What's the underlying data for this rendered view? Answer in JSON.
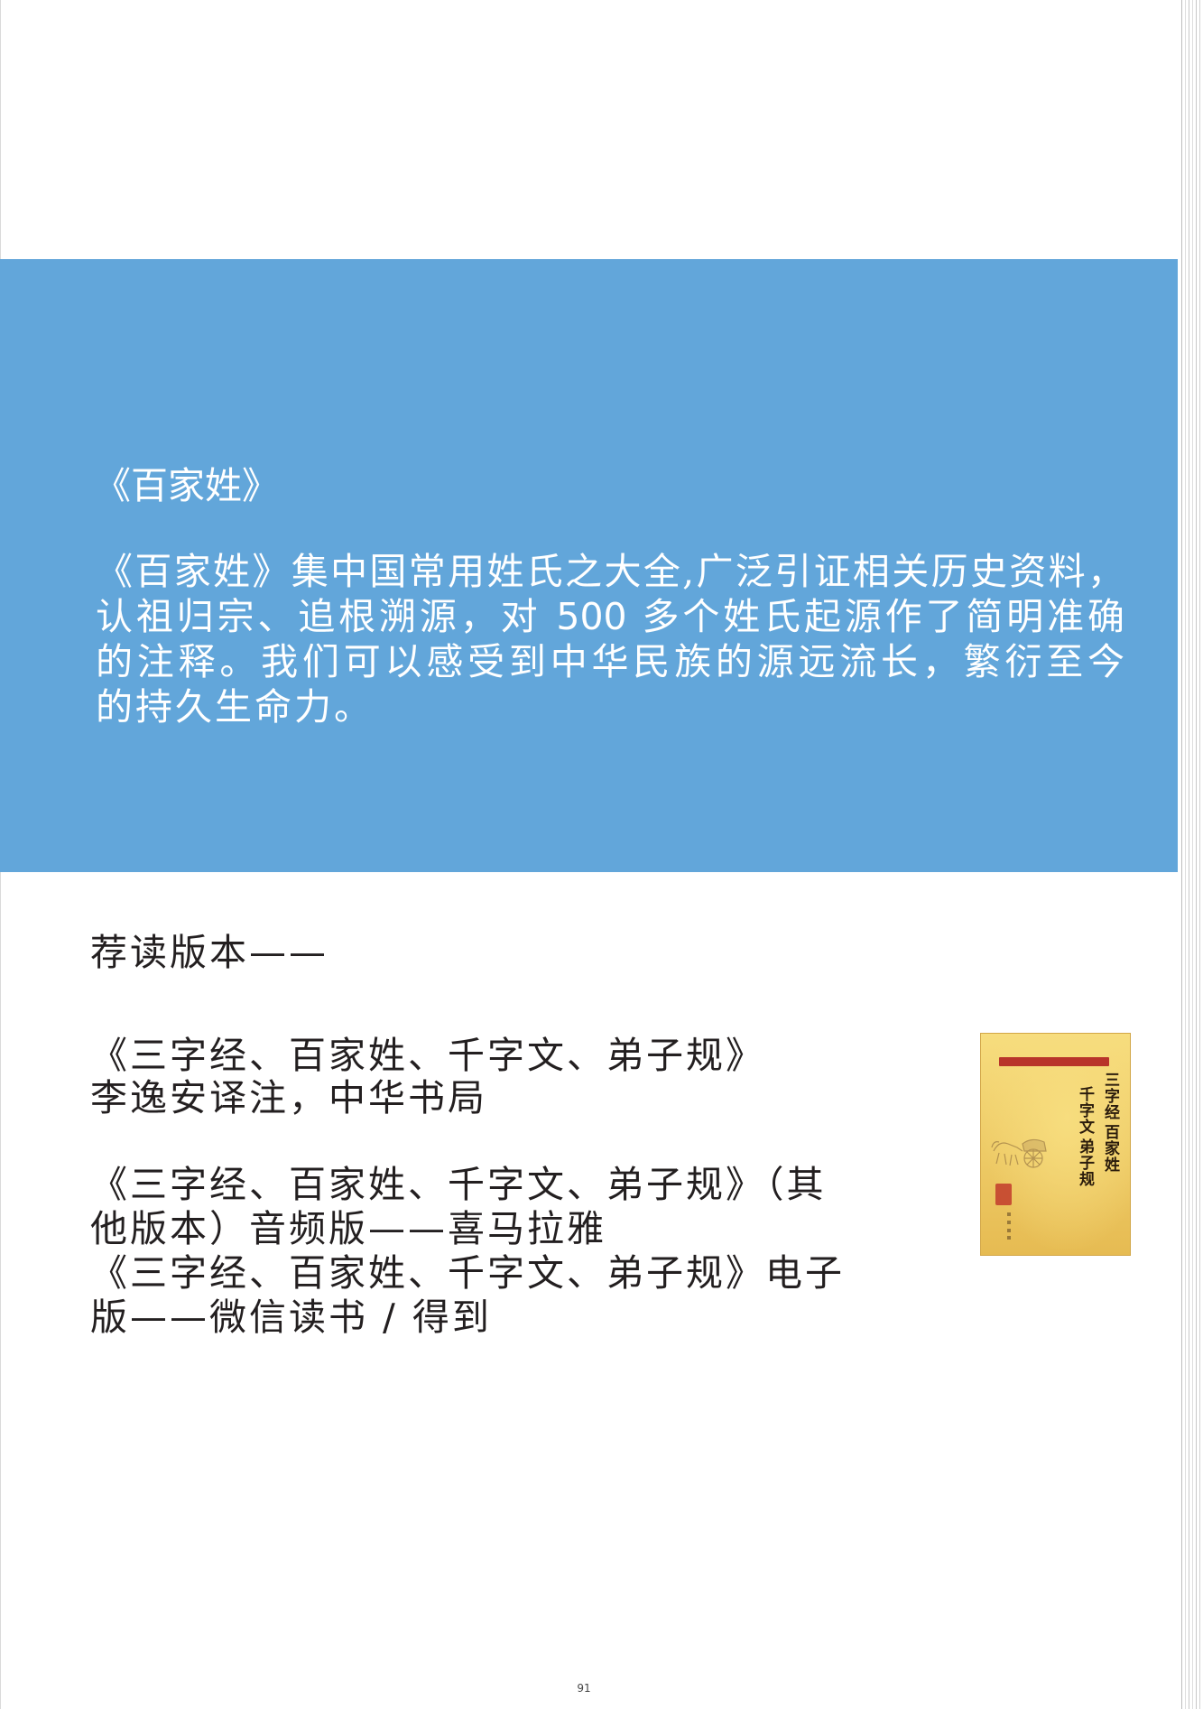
{
  "intro": {
    "title": "《百家姓》",
    "lines": [
      "《百家姓》集中国常用姓氏之大全,广泛引证相关历史资料，",
      "认祖归宗、追根溯源，对 500 多个姓氏起源作了简明准确",
      "的注释。我们可以感受到中华民族的源远流长，繁衍至今",
      "的持久生命力。"
    ]
  },
  "recommend": {
    "heading": "荐读版本——",
    "books": [
      {
        "lines": [
          "《三字经、百家姓、千字文、弟子规》",
          "李逸安译注，中华书局"
        ]
      },
      {
        "lines": [
          "《三字经、百家姓、千字文、弟子规》（其",
          "他版本）音频版——喜马拉雅"
        ]
      },
      {
        "lines": [
          "《三字经、百家姓、千字文、弟子规》电子",
          "版——微信读书 / 得到"
        ]
      }
    ],
    "cover": {
      "titles": [
        "三字经",
        "百家姓",
        "千字文",
        "弟子规"
      ]
    }
  },
  "page": {
    "number": "91"
  },
  "colors": {
    "panel": "#62a6da",
    "panel_text": "#ffffff",
    "body_text": "#231f20",
    "cover_light": "#f7dd7e",
    "cover_dark": "#e6bb52",
    "banner": "#b8342a",
    "seal": "#c23b2c"
  }
}
